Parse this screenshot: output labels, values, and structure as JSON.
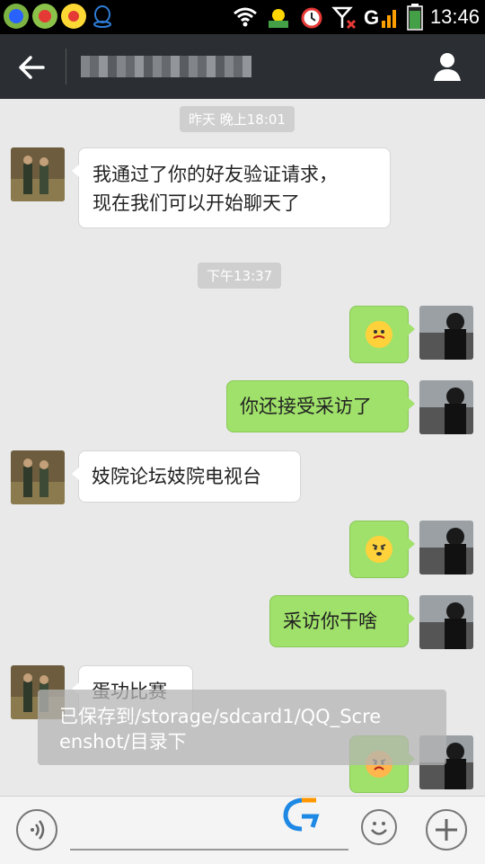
{
  "status_bar": {
    "time": "13:46"
  },
  "header": {
    "back_icon": "arrow-left-icon",
    "title": "",
    "profile_icon": "person-icon"
  },
  "chat": {
    "timestamps": [
      "昨天 晚上18:01",
      "下午13:37"
    ],
    "messages": [
      {
        "side": "in",
        "text": "我通过了你的好友验证请求，\n现在我们可以开始聊天了"
      },
      {
        "side": "out",
        "emoji": "grimace-face"
      },
      {
        "side": "out",
        "text": "你还接受采访了"
      },
      {
        "side": "in",
        "text": "妓院论坛妓院电视台"
      },
      {
        "side": "out",
        "emoji": "angry-face"
      },
      {
        "side": "out",
        "text": "采访你干啥"
      },
      {
        "side": "in",
        "text": "蛋功比赛"
      },
      {
        "side": "out",
        "emoji": "angry-face"
      }
    ]
  },
  "toast": {
    "text": "已保存到/storage/sdcard1/QQ_Scre\nenshot/目录下"
  },
  "input_bar": {
    "voice_icon": "voice-icon",
    "emoji_icon": "smile-icon",
    "plus_icon": "plus-icon"
  }
}
